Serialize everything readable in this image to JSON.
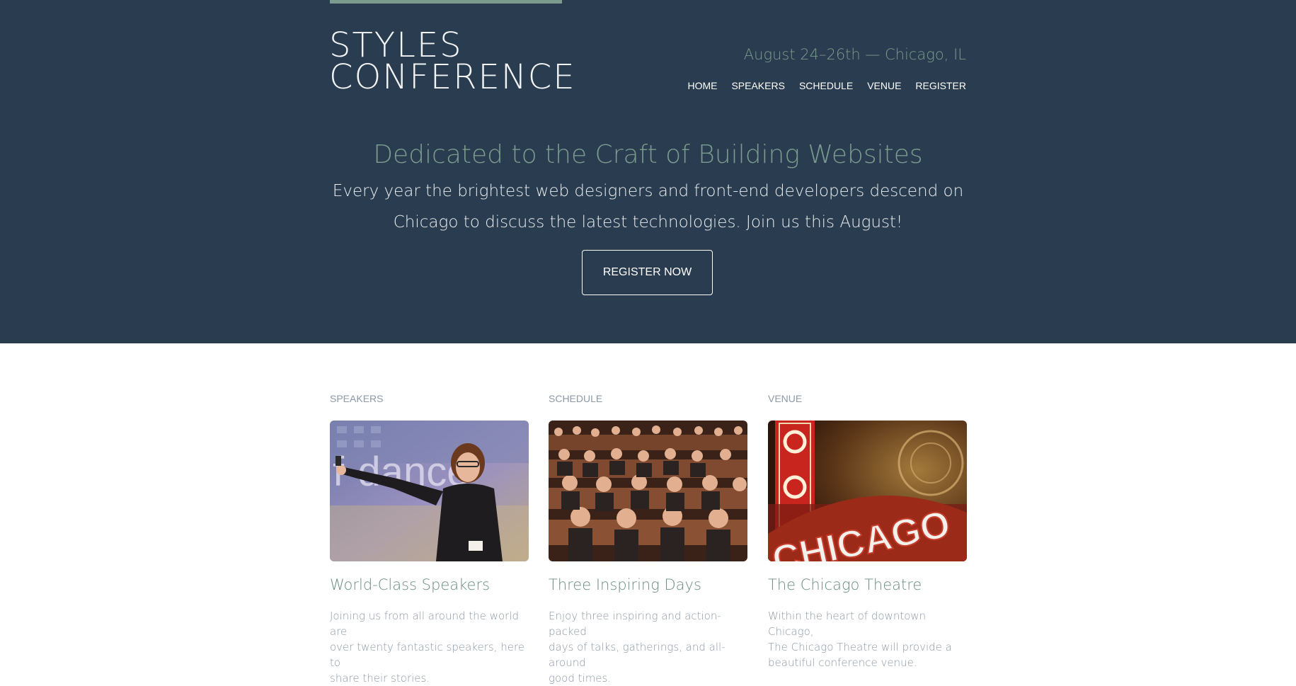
{
  "logo": {
    "line1": "STYLES",
    "line2": "CONFERENCE"
  },
  "tagline": "August 24–26th — Chicago, IL",
  "nav": [
    "HOME",
    "SPEAKERS",
    "SCHEDULE",
    "VENUE",
    "REGISTER"
  ],
  "hero": {
    "title": "Dedicated to the Craft of Building Websites",
    "text_line1": "Every year the brightest web designers and front-end developers descend on",
    "text_line2": "Chicago to discuss the latest technologies. Join us this August!",
    "cta": "REGISTER NOW"
  },
  "columns": [
    {
      "label": "SPEAKERS",
      "title": "World-Class Speakers",
      "text": [
        "Joining us from all around the world are",
        "over twenty fantastic speakers, here to",
        "share their stories."
      ],
      "image_text": "f·dance"
    },
    {
      "label": "SCHEDULE",
      "title": "Three Inspiring Days",
      "text": [
        "Enjoy three inspiring and action-packed",
        "days of talks, gatherings, and all-around",
        "good times."
      ]
    },
    {
      "label": "VENUE",
      "title": "The Chicago Theatre",
      "text": [
        "Within the heart of downtown Chicago,",
        "The Chicago Theatre will provide a",
        "beautiful conference venue."
      ],
      "image_text": "CHICAGO"
    }
  ],
  "colors": {
    "hero_bg": "#2a3c4f",
    "accent": "#7a9b8e",
    "body_text": "#8c99a6"
  }
}
